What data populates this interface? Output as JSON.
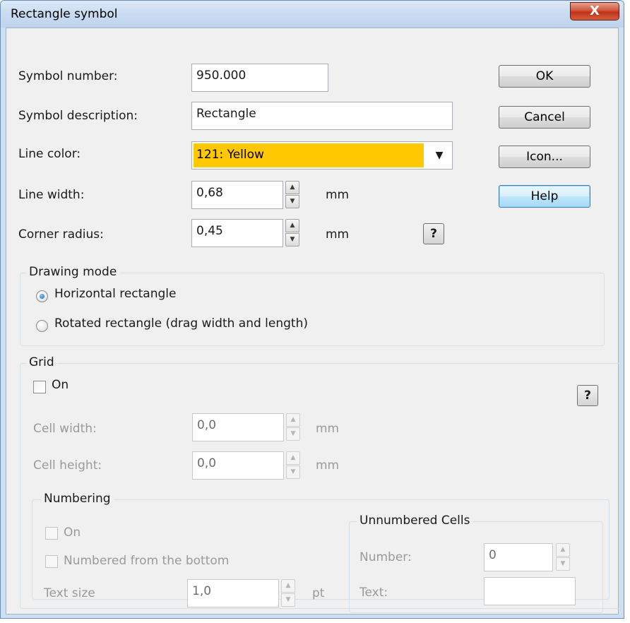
{
  "window": {
    "title": "Rectangle symbol",
    "close_label": "X"
  },
  "fields": {
    "symbol_number": {
      "label": "Symbol number:",
      "value": "950.000"
    },
    "symbol_description": {
      "label": "Symbol description:",
      "value": "Rectangle"
    },
    "line_color": {
      "label": "Line color:",
      "value": "121: Yellow",
      "swatch": "#ffc800"
    },
    "line_width": {
      "label": "Line width:",
      "value": "0,68",
      "unit": "mm"
    },
    "corner_radius": {
      "label": "Corner radius:",
      "value": "0,45",
      "unit": "mm"
    }
  },
  "buttons": {
    "ok": "OK",
    "cancel": "Cancel",
    "icon": "Icon...",
    "help": "Help",
    "question": "?"
  },
  "drawing_mode": {
    "caption": "Drawing mode",
    "options": [
      "Horizontal rectangle",
      "Rotated rectangle (drag width and length)"
    ],
    "selected_index": 0
  },
  "grid": {
    "caption": "Grid",
    "on_label": "On",
    "on_checked": false,
    "cell_width": {
      "label": "Cell width:",
      "value": "0,0",
      "unit": "mm"
    },
    "cell_height": {
      "label": "Cell height:",
      "value": "0,0",
      "unit": "mm"
    },
    "numbering": {
      "caption": "Numbering",
      "on_label": "On",
      "from_bottom_label": "Numbered from the bottom",
      "text_size": {
        "label": "Text size",
        "value": "1,0",
        "unit": "pt"
      }
    },
    "unnumbered": {
      "caption": "Unnumbered Cells",
      "number": {
        "label": "Number:",
        "value": "0"
      },
      "text": {
        "label": "Text:",
        "value": ""
      }
    }
  }
}
